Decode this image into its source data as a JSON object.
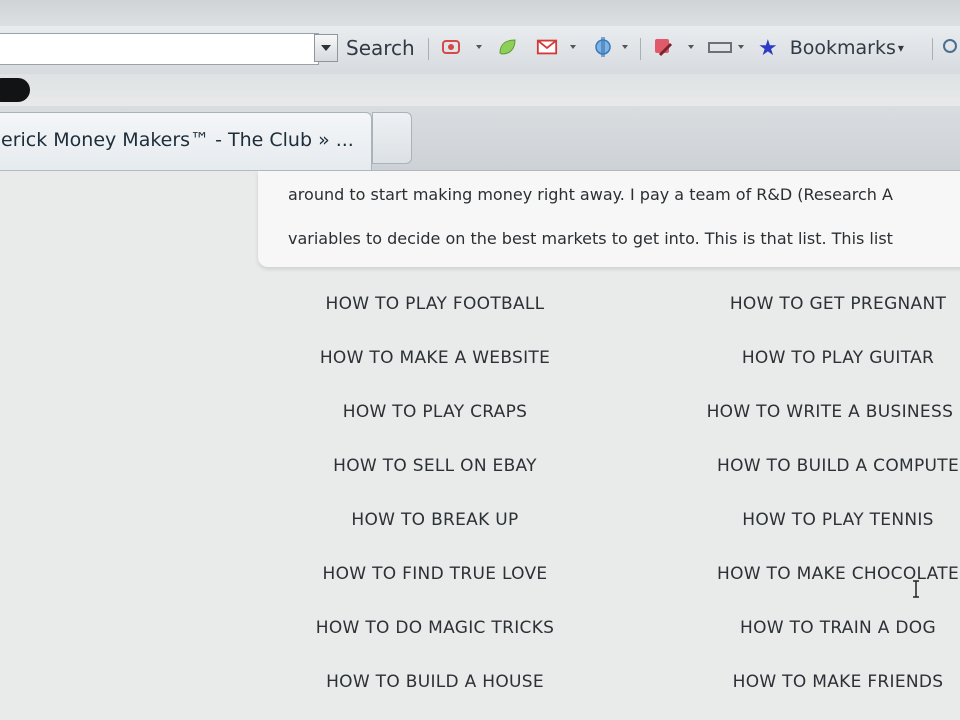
{
  "toolbar": {
    "search_label": "Search",
    "bookmarks_label": "Bookmarks"
  },
  "tab": {
    "title": "erick Money Makers™ - The Club » ..."
  },
  "intro": {
    "line1": "around to start making money right away.  I pay a team of R&D (Research A",
    "line2": "variables to decide on the best markets to get into.  This is that list.  This list"
  },
  "list": {
    "left": [
      "HOW TO PLAY FOOTBALL",
      "HOW TO MAKE A WEBSITE",
      "HOW TO PLAY CRAPS",
      "HOW TO SELL ON EBAY",
      "HOW TO BREAK UP",
      "HOW TO FIND TRUE LOVE",
      "HOW TO DO MAGIC TRICKS",
      "HOW TO BUILD A HOUSE"
    ],
    "right": [
      "HOW TO GET PREGNANT",
      "HOW TO PLAY GUITAR",
      "HOW TO WRITE A BUSINESS P",
      "HOW TO BUILD A COMPUTE",
      "HOW TO PLAY TENNIS",
      "HOW TO MAKE CHOCOLATE",
      "HOW TO TRAIN A DOG",
      "HOW TO MAKE FRIENDS"
    ]
  },
  "colors": {
    "bookmark_star": "#2d3cc4",
    "text": "#2c3136"
  },
  "icons": {
    "toolbar": [
      "gmail-like-icon",
      "leaf-icon",
      "mail-icon",
      "puzzle-icon",
      "pencil-icon",
      "window-icon",
      "star-icon"
    ]
  }
}
